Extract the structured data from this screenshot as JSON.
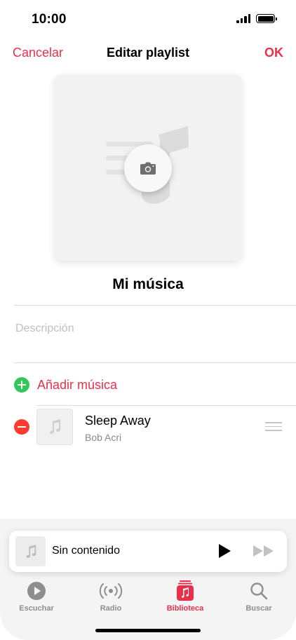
{
  "status_bar": {
    "time": "10:00"
  },
  "nav": {
    "cancel_label": "Cancelar",
    "title": "Editar playlist",
    "ok_label": "OK"
  },
  "playlist": {
    "name": "Mi música",
    "description_placeholder": "Descripción"
  },
  "add_music": {
    "label": "Añadir música"
  },
  "songs": [
    {
      "title": "Sleep Away",
      "artist": "Bob Acri"
    }
  ],
  "mini_player": {
    "title": "Sin contenido"
  },
  "tabs": [
    {
      "label": "Escuchar",
      "icon": "play-circle-icon",
      "active": false
    },
    {
      "label": "Radio",
      "icon": "radio-waves-icon",
      "active": false
    },
    {
      "label": "Biblioteca",
      "icon": "library-icon",
      "active": true
    },
    {
      "label": "Buscar",
      "icon": "search-icon",
      "active": false
    }
  ],
  "colors": {
    "accent": "#e8304a",
    "add_green": "#34c759",
    "remove_red": "#ff3b30",
    "tab_inactive": "#8e8e8e"
  }
}
